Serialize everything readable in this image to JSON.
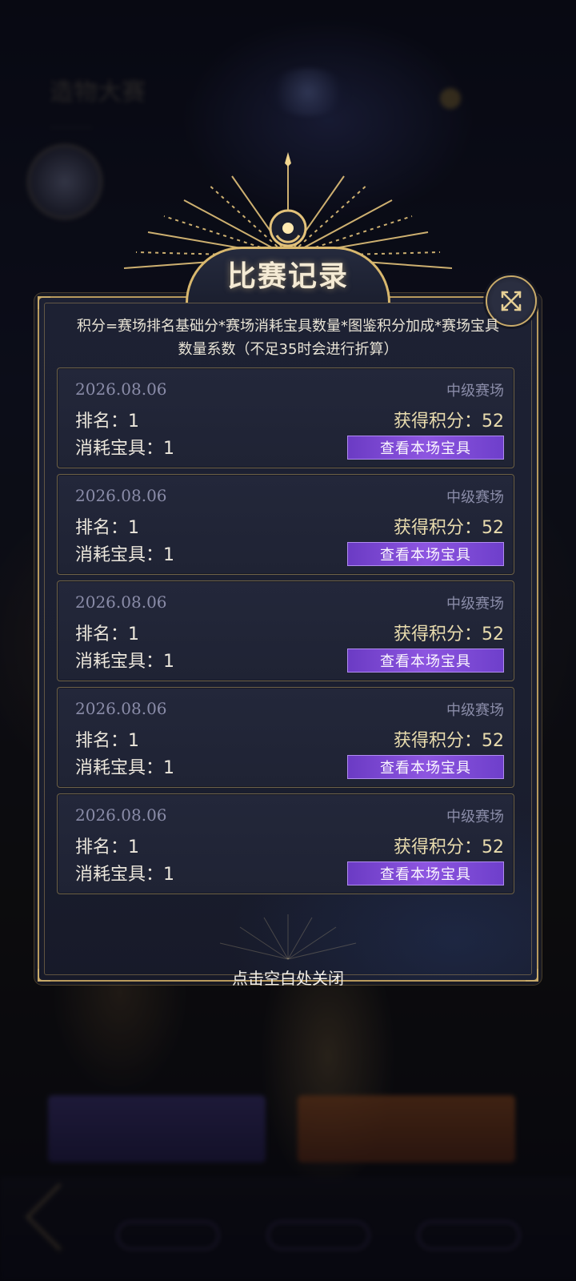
{
  "dialog": {
    "title": "比赛记录",
    "description": "积分=赛场排名基础分*赛场消耗宝具数量*图鉴积分加成*赛场宝具数量系数（不足35时会进行折算）",
    "close_hint": "点击空白处关闭",
    "close_icon": "close-x-icon"
  },
  "records": [
    {
      "date": "2026.08.06",
      "arena": "中级赛场",
      "rank": "排名：1",
      "score": "获得积分：52",
      "cost": "消耗宝具：1",
      "button": "查看本场宝具"
    },
    {
      "date": "2026.08.06",
      "arena": "中级赛场",
      "rank": "排名：1",
      "score": "获得积分：52",
      "cost": "消耗宝具：1",
      "button": "查看本场宝具"
    },
    {
      "date": "2026.08.06",
      "arena": "中级赛场",
      "rank": "排名：1",
      "score": "获得积分：52",
      "cost": "消耗宝具：1",
      "button": "查看本场宝具"
    },
    {
      "date": "2026.08.06",
      "arena": "中级赛场",
      "rank": "排名：1",
      "score": "获得积分：52",
      "cost": "消耗宝具：1",
      "button": "查看本场宝具"
    },
    {
      "date": "2026.08.06",
      "arena": "中级赛场",
      "rank": "排名：1",
      "score": "获得积分：52",
      "cost": "消耗宝具：1",
      "button": "查看本场宝具"
    }
  ],
  "colors": {
    "gold_frame": "#b89a5d",
    "button_purple": "#8d55e0",
    "panel_bg": "#1d2133"
  }
}
